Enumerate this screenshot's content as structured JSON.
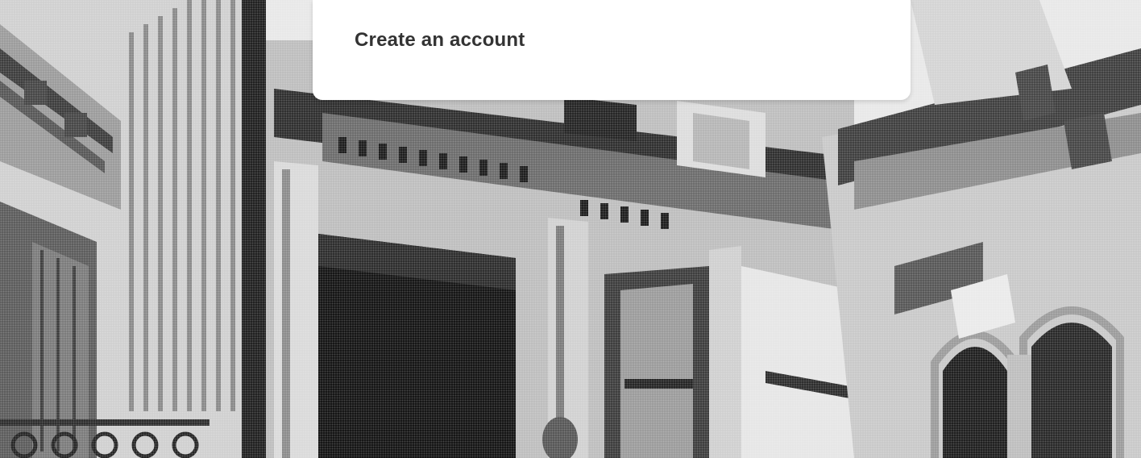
{
  "modal": {
    "title": "Create an account"
  },
  "background": {
    "kind": "halftone-photo-victorian-buildings"
  }
}
